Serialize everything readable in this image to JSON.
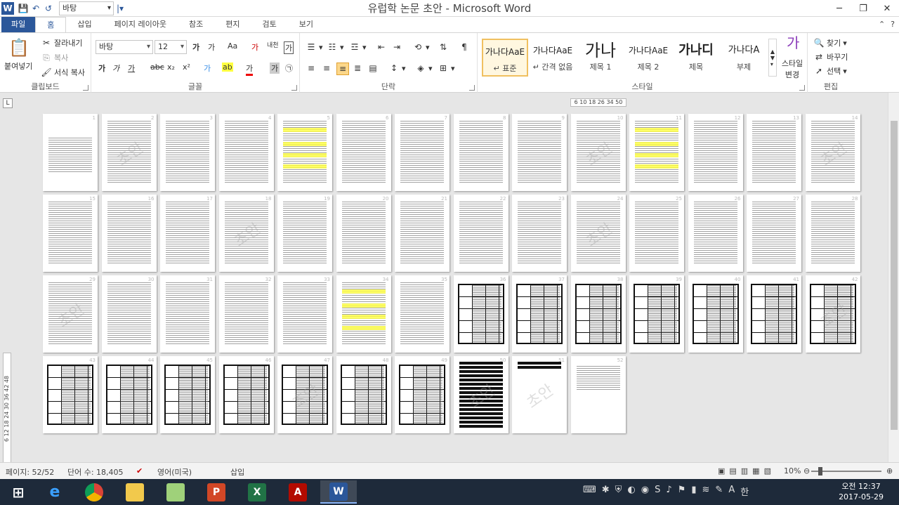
{
  "window": {
    "title": "유럽학 논문 초안  -  Microsoft Word",
    "min": "─",
    "restore": "❐",
    "close": "✕"
  },
  "qat": {
    "font_value": "바탕",
    "save": "💾",
    "undo": "↶",
    "redo": "↺",
    "customize": "|▾"
  },
  "tabs": [
    "파일",
    "홈",
    "삽입",
    "페이지 레이아웃",
    "참조",
    "편지",
    "검토",
    "보기"
  ],
  "active_tab": "홈",
  "tabs_right": {
    "minimize": "⌃",
    "help": "?"
  },
  "ribbon": {
    "clipboard": {
      "label": "클립보드",
      "paste": "붙여넣기",
      "cut": "잘라내기",
      "copy": "복사",
      "format_painter": "서식 복사"
    },
    "font": {
      "label": "글꼴",
      "family": "바탕",
      "size": "12",
      "grow": "가",
      "shrink": "가",
      "case": "Aa",
      "clear": "가",
      "phonetic": "내천",
      "border": "가",
      "bold": "가",
      "italic": "가",
      "underline": "가",
      "strike": "abc",
      "sub": "x₂",
      "sup": "x²",
      "effects": "가",
      "highlight": "ab",
      "color": "가",
      "shade": "가",
      "circle": "㉠"
    },
    "paragraph": {
      "label": "단락"
    },
    "styles": {
      "label": "스타일",
      "items": [
        {
          "sample": "가나다AaE",
          "name": "↵ 표준"
        },
        {
          "sample": "가나다AaE",
          "name": "↵ 간격 없음"
        },
        {
          "sample": "가나",
          "name": "제목 1"
        },
        {
          "sample": "가나다AaE",
          "name": "제목 2"
        },
        {
          "sample": "가나디",
          "name": "제목"
        },
        {
          "sample": "가나다A",
          "name": "부제"
        }
      ],
      "change": "스타일 변경"
    },
    "editing": {
      "label": "편집",
      "find": "찾기",
      "replace": "바꾸기",
      "select": "선택"
    }
  },
  "ruler": {
    "h": "6  10 18 26 34  50",
    "v": "6  12 18 24 30 36 42 48"
  },
  "watermark": "초안",
  "statusbar": {
    "page": "페이지: 52/52",
    "words": "단어 수: 18,405",
    "language": "영어(미국)",
    "mode": "삽입",
    "zoom": "10%"
  },
  "clock": {
    "time": "오전 12:37",
    "date": "2017-05-29"
  },
  "tray_lang": "A",
  "tray_ime": "한",
  "colors": {
    "accent": "#2b579a",
    "taskbar": "#1e2a3a"
  }
}
